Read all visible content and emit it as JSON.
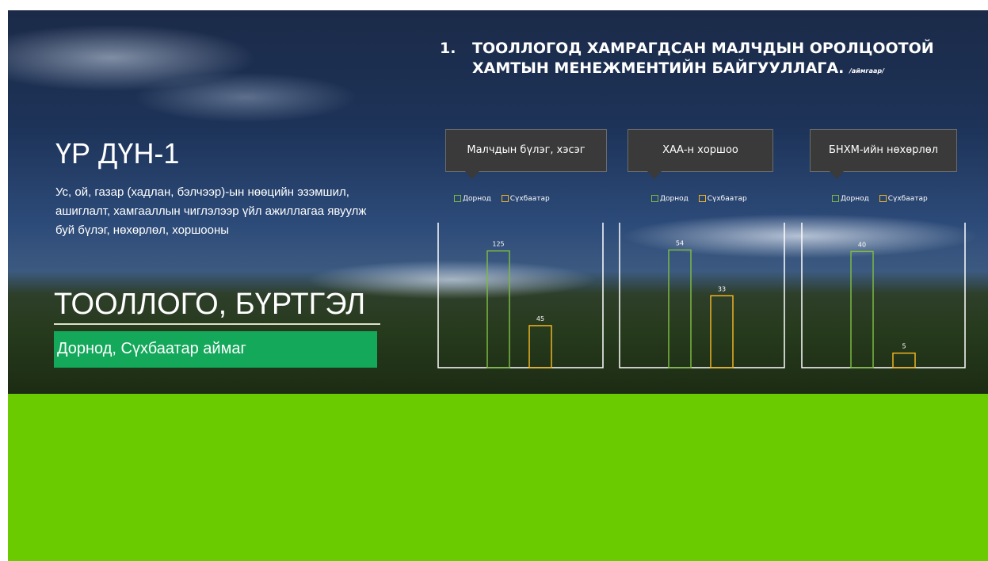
{
  "slide": {
    "title_number": "1.",
    "title_text": "ТООЛЛОГОД ХАМРАГДСАН МАЛЧДЫН ОРОЛЦООТОЙ ХАМТЫН МЕНЕЖМЕНТИЙН БАЙГУУЛЛАГА.",
    "title_suffix": "/аймгаар/",
    "result_heading": "ҮР ДҮН-1",
    "result_description": "Ус, ой, газар (хадлан, бэлчээр)-ын нөөцийн эзэмшил, ашиглалт, хамгааллын чиглэлээр үйл ажиллагаа явуулж буй бүлэг, нөхөрлөл, хоршооны",
    "big_title": "ТООЛЛОГО, БҮРТГЭЛ",
    "region": "Дорнод, Сүхбаатар аймаг",
    "colors": {
      "dornod": "#7db842",
      "sukhbaatar": "#f0b323",
      "region_box": "#13a85a",
      "ground": "#6acc00"
    }
  },
  "chart_data": [
    {
      "type": "bar",
      "title": "Малчдын бүлэг, хэсэг",
      "categories": [
        "Дорнод",
        "Сүхбаатар"
      ],
      "series": [
        {
          "name": "Дорнод",
          "values": [
            125
          ]
        },
        {
          "name": "Сүхбаатар",
          "values": [
            45
          ]
        }
      ],
      "data_labels": [
        "125",
        "45"
      ],
      "ylim": [
        0,
        140
      ],
      "legend": "top"
    },
    {
      "type": "bar",
      "title": "ХАА-н хоршоо",
      "categories": [
        "Дорнод",
        "Сүхбаатар"
      ],
      "series": [
        {
          "name": "Дорнод",
          "values": [
            54
          ]
        },
        {
          "name": "Сүхбаатар",
          "values": [
            33
          ]
        }
      ],
      "data_labels": [
        "54",
        "33"
      ],
      "ylim": [
        0,
        60
      ],
      "legend": "top"
    },
    {
      "type": "bar",
      "title": "БНХМ-ийн нөхөрлөл",
      "categories": [
        "Дорнод",
        "Сүхбаатар"
      ],
      "series": [
        {
          "name": "Дорнод",
          "values": [
            40
          ]
        },
        {
          "name": "Сүхбаатар",
          "values": [
            5
          ]
        }
      ],
      "data_labels": [
        "40",
        "5"
      ],
      "ylim": [
        0,
        45
      ],
      "legend": "top"
    }
  ]
}
